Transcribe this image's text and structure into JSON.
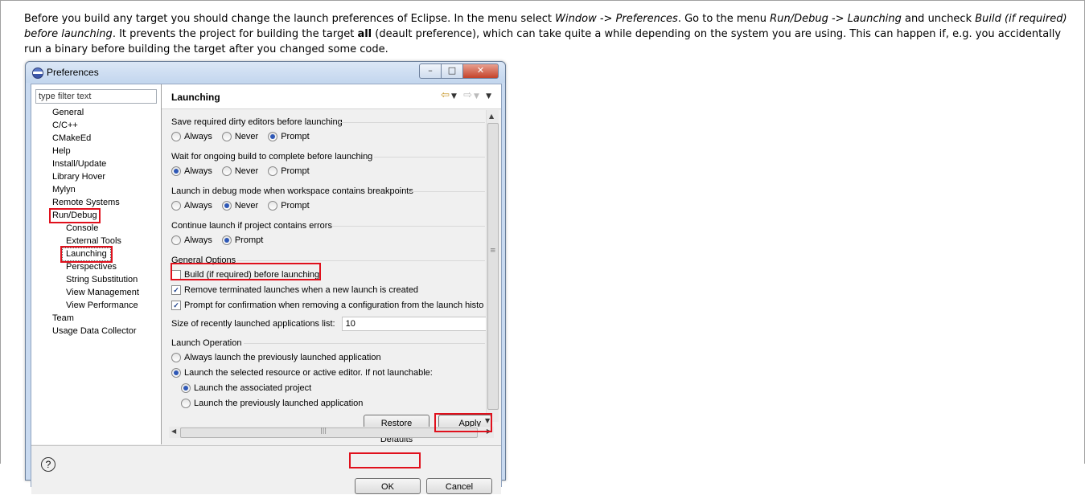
{
  "intro": {
    "p1": "Before you build any target you should change the launch preferences of Eclipse. In the menu select ",
    "menu1": "Window -> Preferences",
    "p2": ". Go to the menu ",
    "menu2": "Run/Debug -> Launching",
    "p3": " and uncheck ",
    "option": "Build (if required) before launching",
    "p4": ". It prevents the project for building the target ",
    "target": "all",
    "p5": " (deault preference), which can take quite a while depending on the system you are using. This can happen if, e.g. you accidentally run a binary before building the target after you changed some code."
  },
  "window": {
    "title": "Preferences",
    "buttons": {
      "minimize": "–",
      "maximize": "□",
      "close": "✕"
    }
  },
  "tree": {
    "filter_placeholder": "type filter text",
    "items": [
      {
        "label": "General"
      },
      {
        "label": "C/C++"
      },
      {
        "label": "CMakeEd"
      },
      {
        "label": "Help"
      },
      {
        "label": "Install/Update"
      },
      {
        "label": "Library Hover"
      },
      {
        "label": "Mylyn"
      },
      {
        "label": "Remote Systems"
      },
      {
        "label": "Run/Debug"
      },
      {
        "label": "Console"
      },
      {
        "label": "External Tools"
      },
      {
        "label": "Launching"
      },
      {
        "label": "Perspectives"
      },
      {
        "label": "String Substitution"
      },
      {
        "label": "View Management"
      },
      {
        "label": "View Performance"
      },
      {
        "label": "Team"
      },
      {
        "label": "Usage Data Collector"
      }
    ]
  },
  "page": {
    "title": "Launching",
    "save_dirty": {
      "title": "Save required dirty editors before launching",
      "options": [
        "Always",
        "Never",
        "Prompt"
      ],
      "selected": "Prompt"
    },
    "wait_build": {
      "title": "Wait for ongoing build to complete before launching",
      "options": [
        "Always",
        "Never",
        "Prompt"
      ],
      "selected": "Always"
    },
    "debug_mode": {
      "title": "Launch in debug mode when workspace contains breakpoints",
      "options": [
        "Always",
        "Never",
        "Prompt"
      ],
      "selected": "Never"
    },
    "errors": {
      "title": "Continue launch if project contains errors",
      "options": [
        "Always",
        "Prompt"
      ],
      "selected": "Prompt"
    },
    "general": {
      "title": "General Options",
      "build_before": {
        "label": "Build (if required) before launching",
        "checked": false
      },
      "remove_terminated": {
        "label": "Remove terminated launches when a new launch is created",
        "checked": true
      },
      "prompt_confirm": {
        "label": "Prompt for confirmation when removing a configuration from the launch histo",
        "checked": true
      },
      "size_label": "Size of recently launched applications list:",
      "size_value": "10"
    },
    "launch_op": {
      "title": "Launch Operation",
      "always_previous": "Always launch the previously launched application",
      "selected_resource": "Launch the selected resource or active editor. If not launchable:",
      "associated": "Launch the associated project",
      "previous": "Launch the previously launched application"
    },
    "restore_defaults": "Restore Defaults",
    "apply": "Apply"
  },
  "footer": {
    "help": "?",
    "ok": "OK",
    "cancel": "Cancel"
  }
}
